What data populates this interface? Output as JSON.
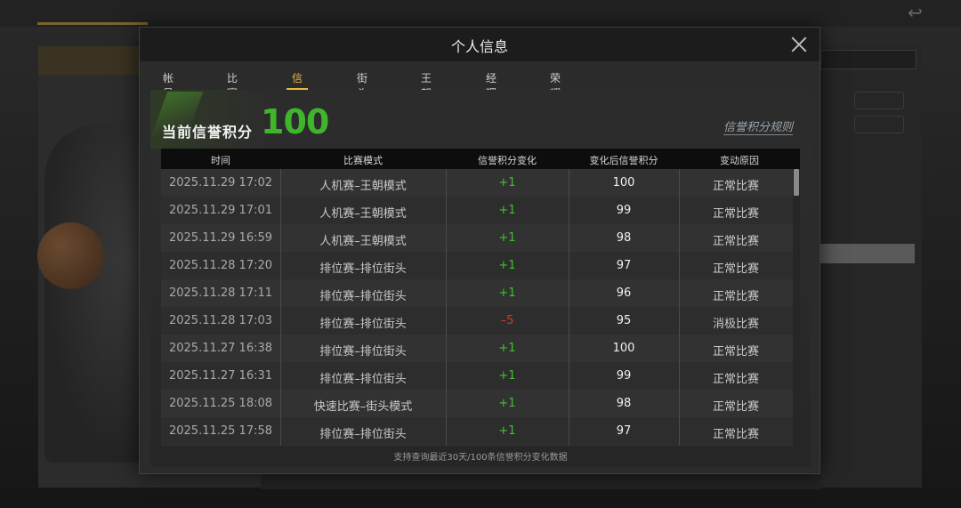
{
  "modal": {
    "title": "个人信息",
    "tabs": [
      {
        "label": "帐号总览",
        "active": false
      },
      {
        "label": "比赛记录",
        "active": false
      },
      {
        "label": "信誉积分",
        "active": true
      },
      {
        "label": "街头模式",
        "active": false
      },
      {
        "label": "王朝模式",
        "active": false
      },
      {
        "label": "经理模式",
        "active": false
      },
      {
        "label": "荣耀成就",
        "active": false
      }
    ],
    "score_label": "当前信誉积分",
    "score_value": "100",
    "rules_link": "信誉积分规则",
    "table": {
      "headers": [
        "时间",
        "比赛模式",
        "信誉积分变化",
        "变化后信誉积分",
        "变动原因"
      ],
      "rows": [
        {
          "time": "2025.11.29  17:02",
          "mode": "人机赛–王朝模式",
          "delta": "+1",
          "after": "100",
          "reason": "正常比赛"
        },
        {
          "time": "2025.11.29  17:01",
          "mode": "人机赛–王朝模式",
          "delta": "+1",
          "after": "99",
          "reason": "正常比赛"
        },
        {
          "time": "2025.11.29  16:59",
          "mode": "人机赛–王朝模式",
          "delta": "+1",
          "after": "98",
          "reason": "正常比赛"
        },
        {
          "time": "2025.11.28  17:20",
          "mode": "排位赛–排位街头",
          "delta": "+1",
          "after": "97",
          "reason": "正常比赛"
        },
        {
          "time": "2025.11.28  17:11",
          "mode": "排位赛–排位街头",
          "delta": "+1",
          "after": "96",
          "reason": "正常比赛"
        },
        {
          "time": "2025.11.28  17:03",
          "mode": "排位赛–排位街头",
          "delta": "–5",
          "after": "95",
          "reason": "消极比赛"
        },
        {
          "time": "2025.11.27  16:38",
          "mode": "排位赛–排位街头",
          "delta": "+1",
          "after": "100",
          "reason": "正常比赛"
        },
        {
          "time": "2025.11.27  16:31",
          "mode": "排位赛–排位街头",
          "delta": "+1",
          "after": "99",
          "reason": "正常比赛"
        },
        {
          "time": "2025.11.25  18:08",
          "mode": "快速比赛–街头模式",
          "delta": "+1",
          "after": "98",
          "reason": "正常比赛"
        },
        {
          "time": "2025.11.25  17:58",
          "mode": "排位赛–排位街头",
          "delta": "+1",
          "after": "97",
          "reason": "正常比赛"
        }
      ]
    },
    "footer_note": "支持查询最近30天/100条信誉积分变化数据"
  },
  "colors": {
    "accent": "#e8b93c",
    "score_green": "#3fb52c",
    "positive": "#3ec12d",
    "negative": "#d63a2a"
  },
  "icons": {
    "close": "close-icon"
  }
}
